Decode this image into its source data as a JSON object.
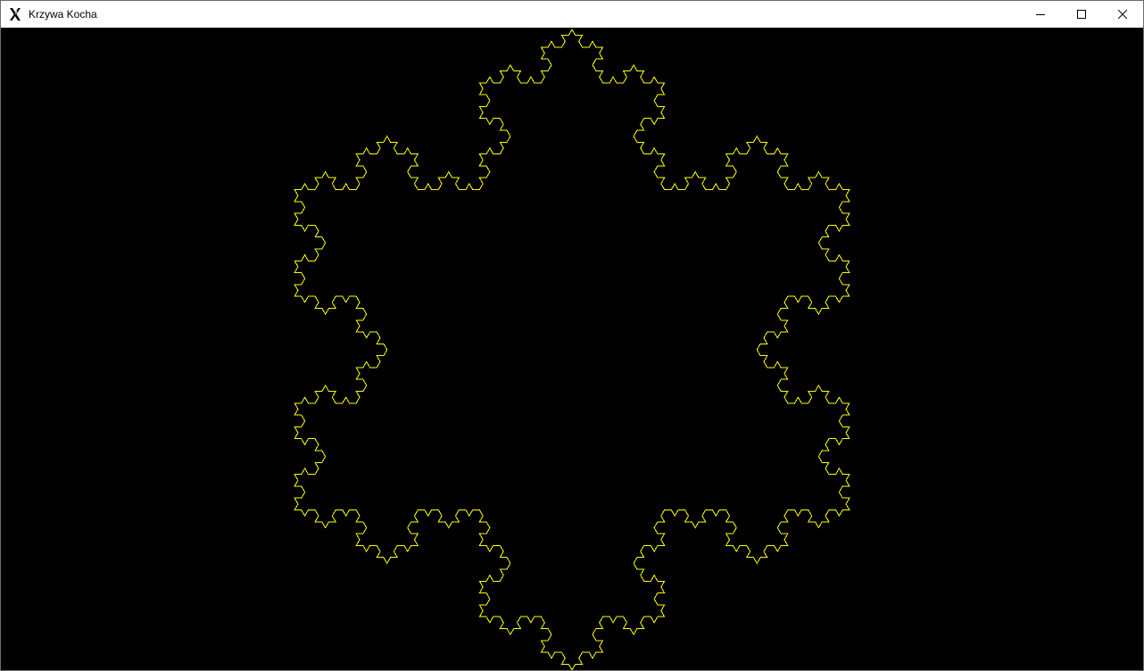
{
  "window": {
    "title": "Krzywa Kocha",
    "icon": "x-logo-icon",
    "controls": [
      "minimize-icon",
      "maximize-icon",
      "close-icon"
    ]
  },
  "canvas": {
    "background": "#000000",
    "stroke_color": "#ffff00",
    "fractal": "koch-snowflake",
    "iterations": 4
  }
}
